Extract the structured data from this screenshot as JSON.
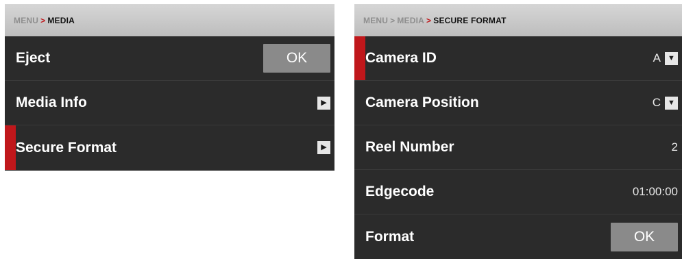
{
  "left_panel": {
    "breadcrumb": {
      "root": "MENU",
      "separator": ">",
      "current": "MEDIA"
    },
    "rows": [
      {
        "label": "Eject",
        "button": "OK"
      },
      {
        "label": "Media Info",
        "icon": "chevron-right-icon"
      },
      {
        "label": "Secure Format",
        "icon": "chevron-right-icon",
        "selected": true
      }
    ]
  },
  "right_panel": {
    "breadcrumb": {
      "root": "MENU",
      "separator": ">",
      "mid": "MEDIA",
      "current": "SECURE FORMAT"
    },
    "rows": [
      {
        "label": "Camera ID",
        "value": "A",
        "icon": "chevron-down-icon",
        "selected": true
      },
      {
        "label": "Camera Position",
        "value": "C",
        "icon": "chevron-down-icon"
      },
      {
        "label": "Reel Number",
        "value": "2"
      },
      {
        "label": "Edgecode",
        "value": "01:00:00"
      },
      {
        "label": "Format",
        "button": "OK"
      }
    ]
  },
  "colors": {
    "panel_bg": "#2b2b2b",
    "header_bg": "#c8c8c8",
    "accent_red": "#c0171b",
    "ok_button": "#8a8a8a"
  }
}
